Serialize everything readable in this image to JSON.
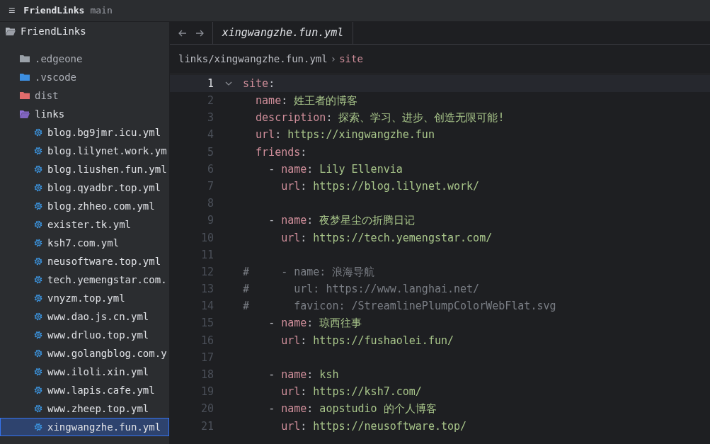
{
  "header": {
    "menu_icon": "≡",
    "project": "FriendLinks",
    "branch": "main"
  },
  "tree": {
    "label": "FriendLinks",
    "kind": "folder",
    "expanded": true,
    "children": [
      {
        "label": ".edgeone",
        "kind": "folder",
        "color": "#9aa1a8",
        "expanded": false
      },
      {
        "label": ".vscode",
        "kind": "folder",
        "color": "#3d8fe0",
        "expanded": false
      },
      {
        "label": "dist",
        "kind": "folder",
        "color": "#e06c6c",
        "expanded": false
      },
      {
        "label": "links",
        "kind": "folder",
        "color": "#8f6fd8",
        "expanded": true,
        "children": [
          {
            "label": "blog.bg9jmr.icu.yml",
            "kind": "file",
            "selected": false
          },
          {
            "label": "blog.lilynet.work.ym",
            "kind": "file",
            "selected": false
          },
          {
            "label": "blog.liushen.fun.yml",
            "kind": "file",
            "selected": false
          },
          {
            "label": "blog.qyadbr.top.yml",
            "kind": "file",
            "selected": false
          },
          {
            "label": "blog.zhheo.com.yml",
            "kind": "file",
            "selected": false
          },
          {
            "label": "exister.tk.yml",
            "kind": "file",
            "selected": false
          },
          {
            "label": "ksh7.com.yml",
            "kind": "file",
            "selected": false
          },
          {
            "label": "neusoftware.top.yml",
            "kind": "file",
            "selected": false
          },
          {
            "label": "tech.yemengstar.com.",
            "kind": "file",
            "selected": false
          },
          {
            "label": "vnyzm.top.yml",
            "kind": "file",
            "selected": false
          },
          {
            "label": "www.dao.js.cn.yml",
            "kind": "file",
            "selected": false
          },
          {
            "label": "www.drluo.top.yml",
            "kind": "file",
            "selected": false
          },
          {
            "label": "www.golangblog.com.y",
            "kind": "file",
            "selected": false
          },
          {
            "label": "www.iloli.xin.yml",
            "kind": "file",
            "selected": false
          },
          {
            "label": "www.lapis.cafe.yml",
            "kind": "file",
            "selected": false
          },
          {
            "label": "www.zheep.top.yml",
            "kind": "file",
            "selected": false
          },
          {
            "label": "xingwangzhe.fun.yml",
            "kind": "file",
            "selected": true
          }
        ]
      }
    ]
  },
  "tabs": [
    {
      "label": "xingwangzhe.fun.yml",
      "selected": true
    }
  ],
  "breadcrumb": {
    "path": "links/xingwangzhe.fun.yml",
    "separator": "›",
    "current": "site"
  },
  "lines": [
    {
      "number": "1",
      "text": "site:",
      "fold": true,
      "current": true
    },
    {
      "number": "2",
      "text": "  name: 姓王者的博客",
      "fold": false,
      "current": false
    },
    {
      "number": "3",
      "text": "  description: 探索、学习、进步、创造无限可能!",
      "fold": false,
      "current": false
    },
    {
      "number": "4",
      "text": "  url: https://xingwangzhe.fun",
      "fold": false,
      "current": false
    },
    {
      "number": "5",
      "text": "  friends:",
      "fold": false,
      "current": false
    },
    {
      "number": "6",
      "text": "    - name: Lily Ellenvia",
      "fold": false,
      "current": false
    },
    {
      "number": "7",
      "text": "      url: https://blog.lilynet.work/",
      "fold": false,
      "current": false
    },
    {
      "number": "8",
      "fold": false,
      "current": false
    },
    {
      "number": "9",
      "text": "    - name: 夜梦星尘の折腾日记",
      "fold": false,
      "current": false
    },
    {
      "number": "10",
      "text": "      url: https://tech.yemengstar.com/",
      "fold": false,
      "current": false
    },
    {
      "number": "11",
      "fold": false,
      "current": false
    },
    {
      "number": "12",
      "text": "#     - name: 浪海导航",
      "fold": false,
      "current": false
    },
    {
      "number": "13",
      "text": "#       url: https://www.langhai.net/",
      "fold": false,
      "current": false
    },
    {
      "number": "14",
      "text": "#       favicon: /StreamlinePlumpColorWebFlat.svg",
      "fold": false,
      "current": false
    },
    {
      "number": "15",
      "text": "    - name: 琼西往事",
      "fold": false,
      "current": false
    },
    {
      "number": "16",
      "text": "      url: https://fushaolei.fun/",
      "fold": false,
      "current": false
    },
    {
      "number": "17",
      "fold": false,
      "current": false
    },
    {
      "number": "18",
      "text": "    - name: ksh",
      "fold": false,
      "current": false
    },
    {
      "number": "19",
      "text": "      url: https://ksh7.com/",
      "fold": false,
      "current": false
    },
    {
      "number": "20",
      "text": "    - name: aopstudio 的个人博客",
      "fold": false,
      "current": false
    },
    {
      "number": "21",
      "text": "      url: https://neusoftware.top/",
      "fold": false,
      "current": false
    }
  ]
}
